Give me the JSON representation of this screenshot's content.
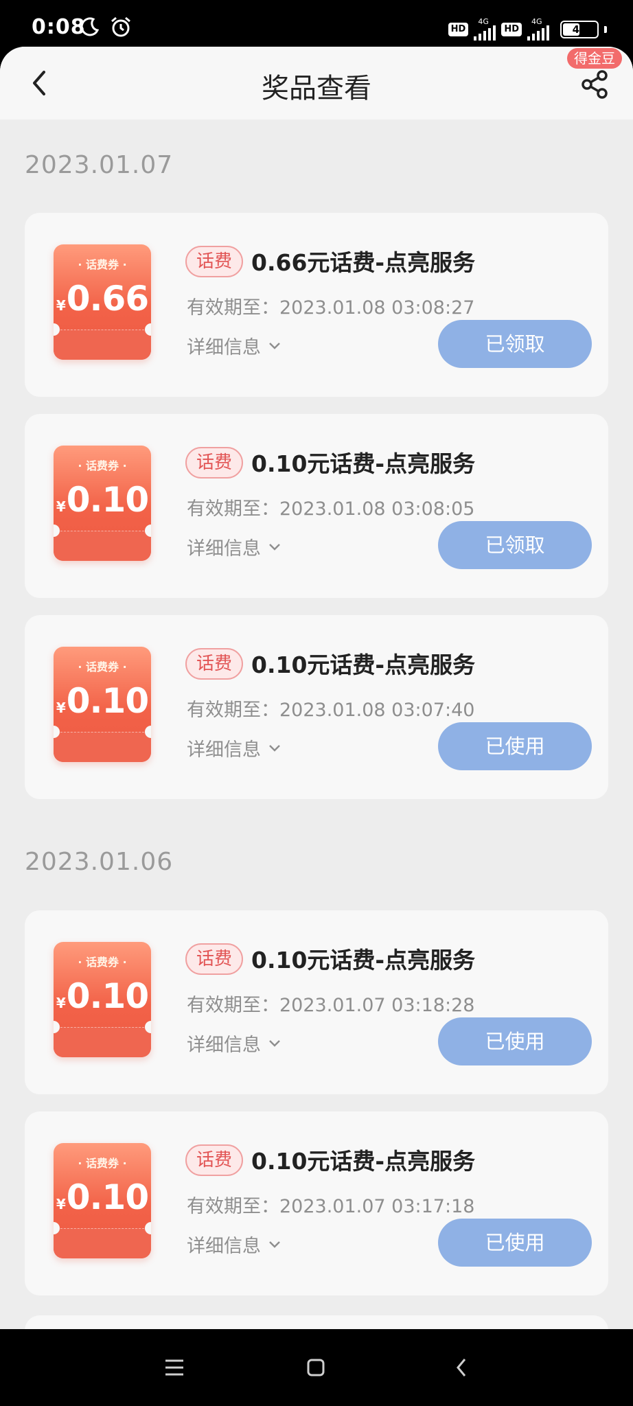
{
  "status_bar": {
    "time": "0:08",
    "battery": "47",
    "network": "4G",
    "hd": "HD"
  },
  "header": {
    "title": "奖品查看",
    "badge": "得金豆"
  },
  "groups": [
    {
      "date": "2023.01.07",
      "items": [
        {
          "ticket_top": "· 话费券 ·",
          "yen": "¥",
          "amount": "0.66",
          "tag": "话费",
          "title": "0.66元话费-点亮服务",
          "expiry": "有效期至：2023.01.08 03:08:27",
          "detail": "详细信息",
          "status": "已领取"
        },
        {
          "ticket_top": "· 话费券 ·",
          "yen": "¥",
          "amount": "0.10",
          "tag": "话费",
          "title": "0.10元话费-点亮服务",
          "expiry": "有效期至：2023.01.08 03:08:05",
          "detail": "详细信息",
          "status": "已领取"
        },
        {
          "ticket_top": "· 话费券 ·",
          "yen": "¥",
          "amount": "0.10",
          "tag": "话费",
          "title": "0.10元话费-点亮服务",
          "expiry": "有效期至：2023.01.08 03:07:40",
          "detail": "详细信息",
          "status": "已使用"
        }
      ]
    },
    {
      "date": "2023.01.06",
      "items": [
        {
          "ticket_top": "· 话费券 ·",
          "yen": "¥",
          "amount": "0.10",
          "tag": "话费",
          "title": "0.10元话费-点亮服务",
          "expiry": "有效期至：2023.01.07 03:18:28",
          "detail": "详细信息",
          "status": "已使用"
        },
        {
          "ticket_top": "· 话费券 ·",
          "yen": "¥",
          "amount": "0.10",
          "tag": "话费",
          "title": "0.10元话费-点亮服务",
          "expiry": "有效期至：2023.01.07 03:17:18",
          "detail": "详细信息",
          "status": "已使用"
        }
      ]
    }
  ],
  "colors": {
    "accent_button": "#8fb1e5",
    "ticket_red": "#f26248",
    "tag_red": "#e25555"
  },
  "icons": {
    "back": "chevron-left-icon",
    "share": "share-icon",
    "menu": "menu-icon",
    "home": "home-icon",
    "nav_back": "nav-back-icon"
  }
}
